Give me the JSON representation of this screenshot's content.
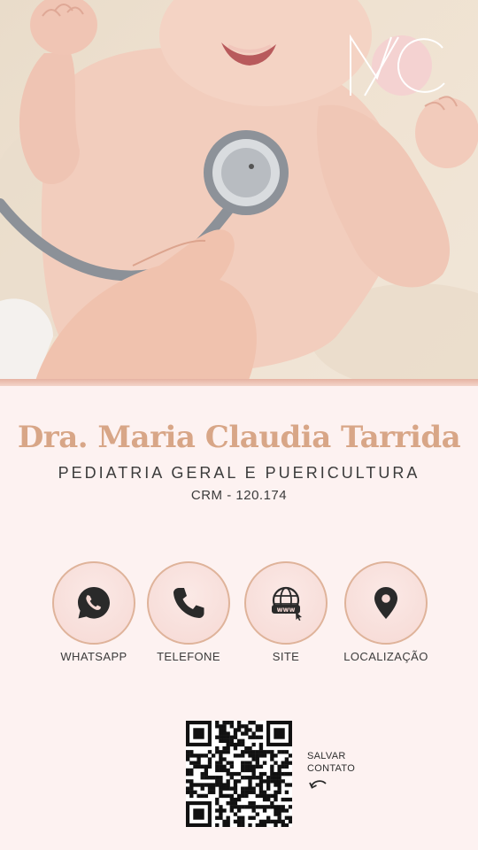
{
  "logo": {
    "monogram": "MC",
    "icon": "mc-monogram-logo"
  },
  "profile": {
    "name": "Dra. Maria Claudia Tarrida",
    "specialty": "PEDIATRIA GERAL E PUERICULTURA",
    "crm": "CRM - 120.174"
  },
  "actions": [
    {
      "label": "WHATSAPP",
      "icon": "whatsapp-icon"
    },
    {
      "label": "TELEFONE",
      "icon": "phone-icon"
    },
    {
      "label": "SITE",
      "icon": "www-globe-icon"
    },
    {
      "label": "LOCALIZAÇÃO",
      "icon": "location-pin-icon"
    }
  ],
  "save_contact": {
    "line1": "SALVAR",
    "line2": "CONTATO",
    "icon": "curved-arrow-icon"
  },
  "colors": {
    "accent": "#d8a687",
    "background": "#fdf2f1",
    "button_fill": "#f6d9d4",
    "button_border": "#dfb39a",
    "text": "#3b3b3b"
  }
}
